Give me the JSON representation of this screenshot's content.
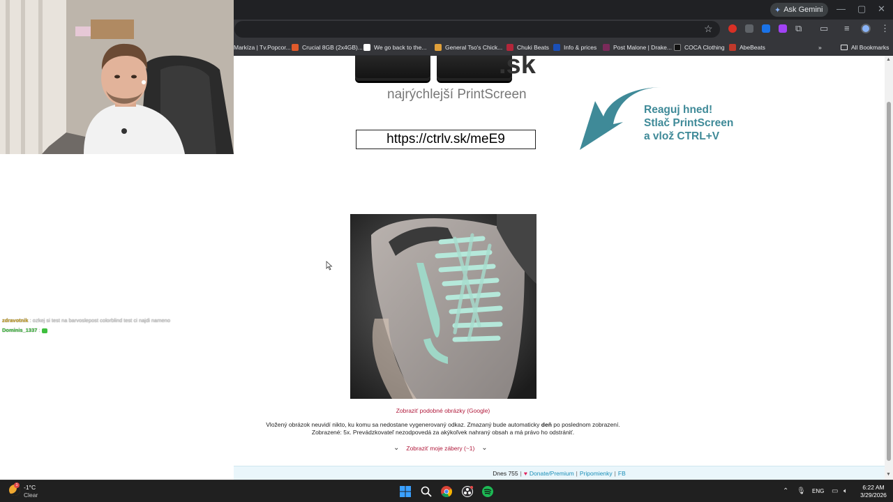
{
  "browser": {
    "gemini_label": "Ask Gemini",
    "bookmarks": [
      {
        "label": "Markíza | Tv.Popcor...",
        "color": "#c0392b",
        "icon": "bookmark-favicon"
      },
      {
        "label": "Crucial 8GB (2x4GB)...",
        "color": "#e05a2b",
        "icon": "bookmark-favicon"
      },
      {
        "label": "We go back to the...",
        "color": "#ffffff",
        "icon": "google-favicon"
      },
      {
        "label": "General Tso's Chick...",
        "color": "#e0a03a",
        "icon": "bookmark-favicon"
      },
      {
        "label": "Chuki Beats",
        "color": "#b3263a",
        "icon": "bookmark-favicon"
      },
      {
        "label": "Info & prices",
        "color": "#1a4fb8",
        "icon": "bookmark-favicon"
      },
      {
        "label": "Post Malone | Drake...",
        "color": "#7a2a5a",
        "icon": "bookmark-favicon"
      },
      {
        "label": "COCA Clothing",
        "color": "#111111",
        "icon": "bookmark-favicon"
      },
      {
        "label": "AbeBeats",
        "color": "#c0392b",
        "icon": "bookmark-favicon"
      }
    ],
    "all_bookmarks": "All Bookmarks"
  },
  "page": {
    "logo_tld": ".sk",
    "tagline": "najrýchlejší PrintScreen",
    "link": "https://ctrlv.sk/meE9",
    "promo": {
      "line1": "Reaguj hned!",
      "line2": "Stlač PrintScreen",
      "line3": "a vlož CTRL+V"
    },
    "similar_link": "Zobraziť podobné obrázky (Google)",
    "info_part1": "Vložený obrázok neuvidí nikto, ku komu sa nedostane vygenerovaný odkaz. Zmazaný bude automaticky ",
    "info_bold": "deň",
    "info_part2": " po poslednom zobrazení.",
    "info_line2": "Zobrazené: 5x. Prevádzkovateľ nezodpovedá za akýkoľvek nahraný obsah a má právo ho odstrániť.",
    "my_shots": "Zobraziť moje zábery (~1)",
    "footer": {
      "today": "Dnes 755",
      "sep1": "|",
      "heart": "♥",
      "donate": "Donate/Premium",
      "sep2": "|",
      "feedback": "Pripomienky",
      "sep3": "|",
      "fb": "FB"
    }
  },
  "chat": [
    {
      "user": "zdravotnik",
      "sep": ":",
      "text": "ozkej si test na barvoslepost colorblind test ci najdi nameno",
      "color": "#c9a227"
    },
    {
      "user": "Dominis_1337",
      "sep": ":",
      "text": "",
      "color": "#3fbf3f"
    }
  ],
  "taskbar": {
    "notif_count": "1",
    "temp": "-1°C",
    "weather": "Clear",
    "lang": "ENG",
    "time": "6:22 AM",
    "date": "3/29/2026"
  }
}
